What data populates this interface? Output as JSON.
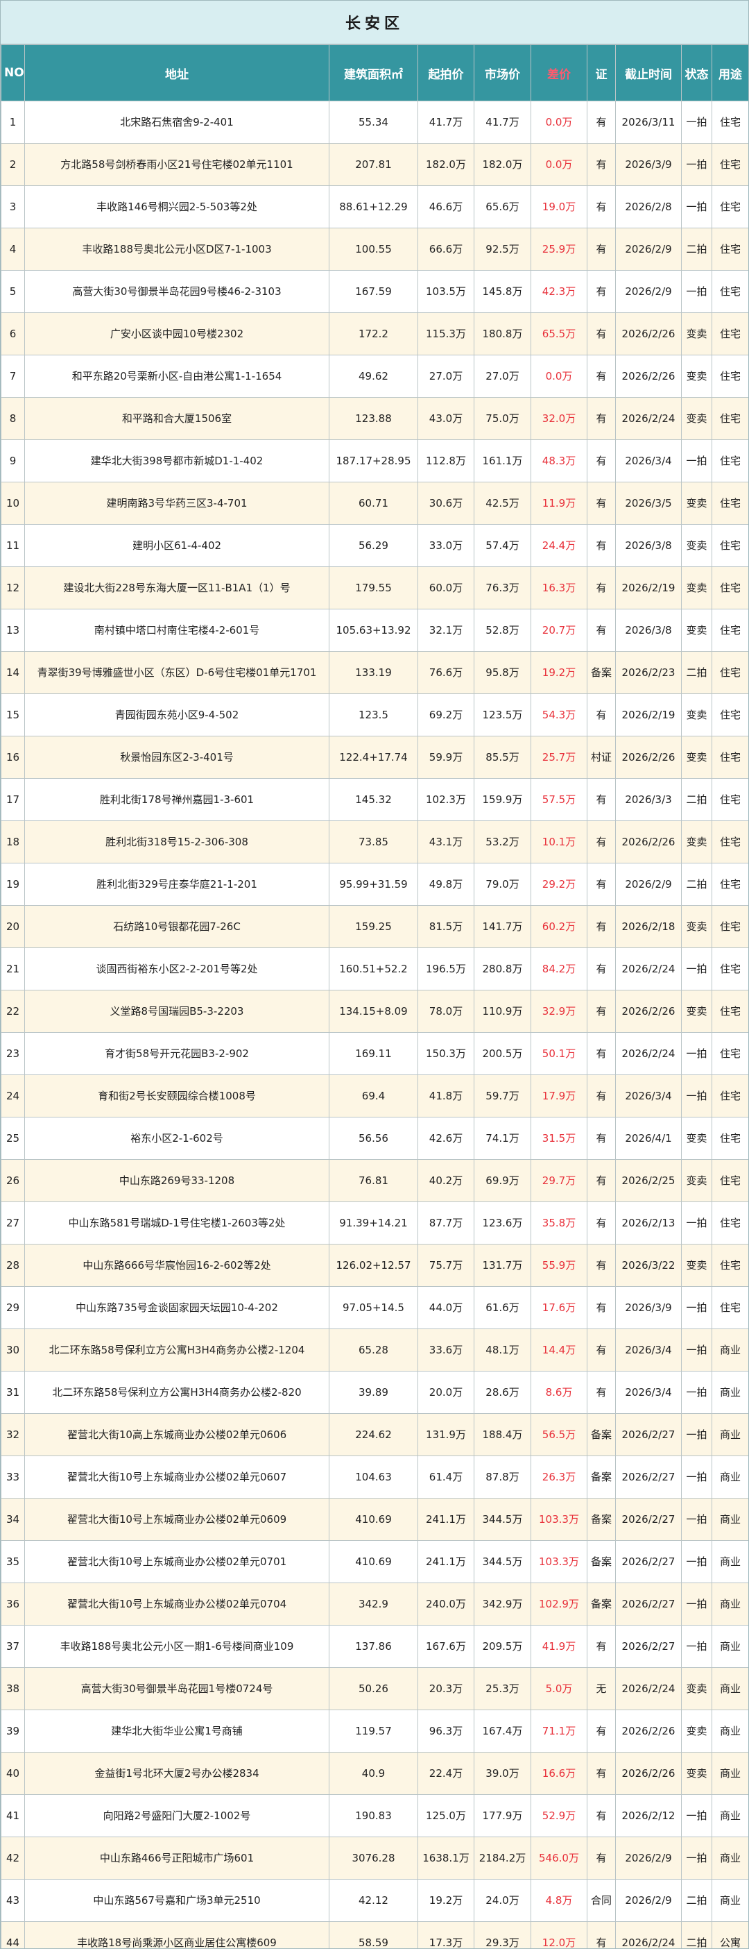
{
  "title": "长安区",
  "colors": {
    "header_bg": "#3596a0",
    "title_bg": "#d8eef1",
    "stripe": "#fdf6e4",
    "diff_red": "#e8303a"
  },
  "columns": [
    "NO.",
    "地址",
    "建筑面积㎡",
    "起拍价",
    "市场价",
    "差价",
    "证",
    "截止时间",
    "状态",
    "用途"
  ],
  "rows": [
    [
      "1",
      "北宋路石焦宿舍9-2-401",
      "55.34",
      "41.7万",
      "41.7万",
      "0.0万",
      "有",
      "2026/3/11",
      "一拍",
      "住宅"
    ],
    [
      "2",
      "方北路58号剑桥春雨小区21号住宅楼02单元1101",
      "207.81",
      "182.0万",
      "182.0万",
      "0.0万",
      "有",
      "2026/3/9",
      "一拍",
      "住宅"
    ],
    [
      "3",
      "丰收路146号桐兴园2-5-503等2处",
      "88.61+12.29",
      "46.6万",
      "65.6万",
      "19.0万",
      "有",
      "2026/2/8",
      "一拍",
      "住宅"
    ],
    [
      "4",
      "丰收路188号奥北公元小区D区7-1-1003",
      "100.55",
      "66.6万",
      "92.5万",
      "25.9万",
      "有",
      "2026/2/9",
      "二拍",
      "住宅"
    ],
    [
      "5",
      "高营大街30号御景半岛花园9号楼46-2-3103",
      "167.59",
      "103.5万",
      "145.8万",
      "42.3万",
      "有",
      "2026/2/9",
      "一拍",
      "住宅"
    ],
    [
      "6",
      "广安小区谈中园10号楼2302",
      "172.2",
      "115.3万",
      "180.8万",
      "65.5万",
      "有",
      "2026/2/26",
      "变卖",
      "住宅"
    ],
    [
      "7",
      "和平东路20号栗新小区-自由港公寓1-1-1654",
      "49.62",
      "27.0万",
      "27.0万",
      "0.0万",
      "有",
      "2026/2/26",
      "变卖",
      "住宅"
    ],
    [
      "8",
      "和平路和合大厦1506室",
      "123.88",
      "43.0万",
      "75.0万",
      "32.0万",
      "有",
      "2026/2/24",
      "变卖",
      "住宅"
    ],
    [
      "9",
      "建华北大街398号都市新城D1-1-402",
      "187.17+28.95",
      "112.8万",
      "161.1万",
      "48.3万",
      "有",
      "2026/3/4",
      "一拍",
      "住宅"
    ],
    [
      "10",
      "建明南路3号华药三区3-4-701",
      "60.71",
      "30.6万",
      "42.5万",
      "11.9万",
      "有",
      "2026/3/5",
      "变卖",
      "住宅"
    ],
    [
      "11",
      "建明小区61-4-402",
      "56.29",
      "33.0万",
      "57.4万",
      "24.4万",
      "有",
      "2026/3/8",
      "变卖",
      "住宅"
    ],
    [
      "12",
      "建设北大街228号东海大厦一区11-B1A1（1）号",
      "179.55",
      "60.0万",
      "76.3万",
      "16.3万",
      "有",
      "2026/2/19",
      "变卖",
      "住宅"
    ],
    [
      "13",
      "南村镇中塔口村南住宅楼4-2-601号",
      "105.63+13.92",
      "32.1万",
      "52.8万",
      "20.7万",
      "有",
      "2026/3/8",
      "变卖",
      "住宅"
    ],
    [
      "14",
      "青翠街39号博雅盛世小区（东区）D-6号住宅楼01单元1701",
      "133.19",
      "76.6万",
      "95.8万",
      "19.2万",
      "备案",
      "2026/2/23",
      "二拍",
      "住宅"
    ],
    [
      "15",
      "青园街园东苑小区9-4-502",
      "123.5",
      "69.2万",
      "123.5万",
      "54.3万",
      "有",
      "2026/2/19",
      "变卖",
      "住宅"
    ],
    [
      "16",
      "秋景怡园东区2-3-401号",
      "122.4+17.74",
      "59.9万",
      "85.5万",
      "25.7万",
      "村证",
      "2026/2/26",
      "变卖",
      "住宅"
    ],
    [
      "17",
      "胜利北街178号禅州嘉园1-3-601",
      "145.32",
      "102.3万",
      "159.9万",
      "57.5万",
      "有",
      "2026/3/3",
      "二拍",
      "住宅"
    ],
    [
      "18",
      "胜利北街318号15-2-306-308",
      "73.85",
      "43.1万",
      "53.2万",
      "10.1万",
      "有",
      "2026/2/26",
      "变卖",
      "住宅"
    ],
    [
      "19",
      "胜利北街329号庄泰华庭21-1-201",
      "95.99+31.59",
      "49.8万",
      "79.0万",
      "29.2万",
      "有",
      "2026/2/9",
      "二拍",
      "住宅"
    ],
    [
      "20",
      "石纺路10号银都花园7-26C",
      "159.25",
      "81.5万",
      "141.7万",
      "60.2万",
      "有",
      "2026/2/18",
      "变卖",
      "住宅"
    ],
    [
      "21",
      "谈固西街裕东小区2-2-201号等2处",
      "160.51+52.2",
      "196.5万",
      "280.8万",
      "84.2万",
      "有",
      "2026/2/24",
      "一拍",
      "住宅"
    ],
    [
      "22",
      "义堂路8号国瑞园B5-3-2203",
      "134.15+8.09",
      "78.0万",
      "110.9万",
      "32.9万",
      "有",
      "2026/2/26",
      "变卖",
      "住宅"
    ],
    [
      "23",
      "育才街58号开元花园B3-2-902",
      "169.11",
      "150.3万",
      "200.5万",
      "50.1万",
      "有",
      "2026/2/24",
      "一拍",
      "住宅"
    ],
    [
      "24",
      "育和街2号长安颐园综合楼1008号",
      "69.4",
      "41.8万",
      "59.7万",
      "17.9万",
      "有",
      "2026/3/4",
      "一拍",
      "住宅"
    ],
    [
      "25",
      "裕东小区2-1-602号",
      "56.56",
      "42.6万",
      "74.1万",
      "31.5万",
      "有",
      "2026/4/1",
      "变卖",
      "住宅"
    ],
    [
      "26",
      "中山东路269号33-1208",
      "76.81",
      "40.2万",
      "69.9万",
      "29.7万",
      "有",
      "2026/2/25",
      "变卖",
      "住宅"
    ],
    [
      "27",
      "中山东路581号瑞城D-1号住宅楼1-2603等2处",
      "91.39+14.21",
      "87.7万",
      "123.6万",
      "35.8万",
      "有",
      "2026/2/13",
      "一拍",
      "住宅"
    ],
    [
      "28",
      "中山东路666号华宸怡园16-2-602等2处",
      "126.02+12.57",
      "75.7万",
      "131.7万",
      "55.9万",
      "有",
      "2026/3/22",
      "变卖",
      "住宅"
    ],
    [
      "29",
      "中山东路735号金谈固家园天坛园10-4-202",
      "97.05+14.5",
      "44.0万",
      "61.6万",
      "17.6万",
      "有",
      "2026/3/9",
      "一拍",
      "住宅"
    ],
    [
      "30",
      "北二环东路58号保利立方公寓H3H4商务办公楼2-1204",
      "65.28",
      "33.6万",
      "48.1万",
      "14.4万",
      "有",
      "2026/3/4",
      "一拍",
      "商业"
    ],
    [
      "31",
      "北二环东路58号保利立方公寓H3H4商务办公楼2-820",
      "39.89",
      "20.0万",
      "28.6万",
      "8.6万",
      "有",
      "2026/3/4",
      "一拍",
      "商业"
    ],
    [
      "32",
      "翟营北大街10高上东城商业办公楼02单元0606",
      "224.62",
      "131.9万",
      "188.4万",
      "56.5万",
      "备案",
      "2026/2/27",
      "一拍",
      "商业"
    ],
    [
      "33",
      "翟营北大街10号上东城商业办公楼02单元0607",
      "104.63",
      "61.4万",
      "87.8万",
      "26.3万",
      "备案",
      "2026/2/27",
      "一拍",
      "商业"
    ],
    [
      "34",
      "翟营北大街10号上东城商业办公楼02单元0609",
      "410.69",
      "241.1万",
      "344.5万",
      "103.3万",
      "备案",
      "2026/2/27",
      "一拍",
      "商业"
    ],
    [
      "35",
      "翟营北大街10号上东城商业办公楼02单元0701",
      "410.69",
      "241.1万",
      "344.5万",
      "103.3万",
      "备案",
      "2026/2/27",
      "一拍",
      "商业"
    ],
    [
      "36",
      "翟营北大街10号上东城商业办公楼02单元0704",
      "342.9",
      "240.0万",
      "342.9万",
      "102.9万",
      "备案",
      "2026/2/27",
      "一拍",
      "商业"
    ],
    [
      "37",
      "丰收路188号奥北公元小区一期1-6号楼间商业109",
      "137.86",
      "167.6万",
      "209.5万",
      "41.9万",
      "有",
      "2026/2/27",
      "一拍",
      "商业"
    ],
    [
      "38",
      "高营大街30号御景半岛花园1号楼0724号",
      "50.26",
      "20.3万",
      "25.3万",
      "5.0万",
      "无",
      "2026/2/24",
      "变卖",
      "商业"
    ],
    [
      "39",
      "建华北大街华业公寓1号商铺",
      "119.57",
      "96.3万",
      "167.4万",
      "71.1万",
      "有",
      "2026/2/26",
      "变卖",
      "商业"
    ],
    [
      "40",
      "金益街1号北环大厦2号办公楼2834",
      "40.9",
      "22.4万",
      "39.0万",
      "16.6万",
      "有",
      "2026/2/26",
      "变卖",
      "商业"
    ],
    [
      "41",
      "向阳路2号盛阳门大厦2-1002号",
      "190.83",
      "125.0万",
      "177.9万",
      "52.9万",
      "有",
      "2026/2/12",
      "一拍",
      "商业"
    ],
    [
      "42",
      "中山东路466号正阳城市广场601",
      "3076.28",
      "1638.1万",
      "2184.2万",
      "546.0万",
      "有",
      "2026/2/9",
      "一拍",
      "商业"
    ],
    [
      "43",
      "中山东路567号嘉和广场3单元2510",
      "42.12",
      "19.2万",
      "24.0万",
      "4.8万",
      "合同",
      "2026/2/9",
      "二拍",
      "商业"
    ],
    [
      "44",
      "丰收路18号尚乘源小区商业居住公寓楼609",
      "58.59",
      "17.3万",
      "29.3万",
      "12.0万",
      "有",
      "2026/2/24",
      "二拍",
      "公寓"
    ]
  ]
}
